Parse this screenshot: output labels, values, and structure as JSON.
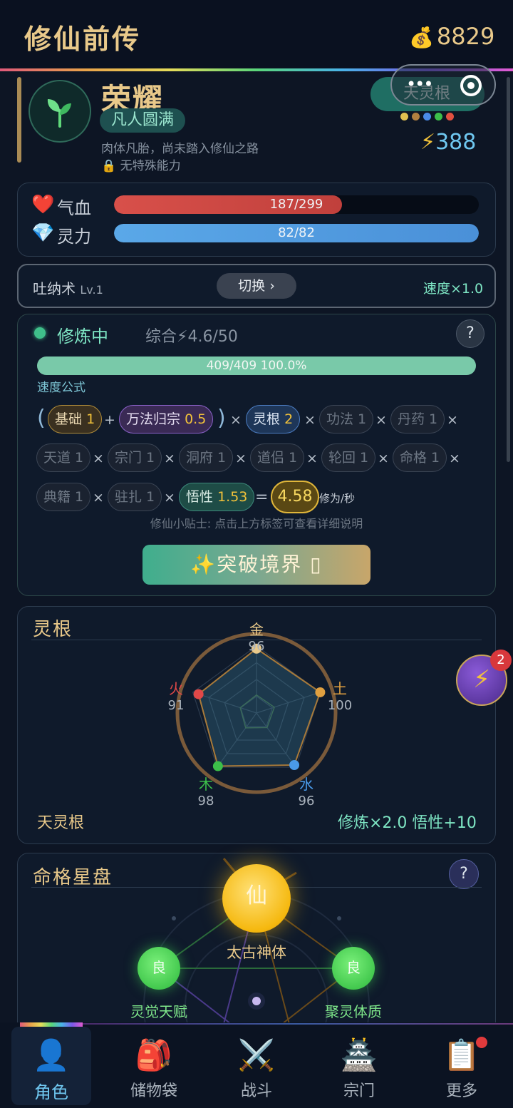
{
  "header": {
    "title": "修仙前传",
    "coin_icon": "money-bag-icon",
    "coins": "8829"
  },
  "profile": {
    "name": "荣耀",
    "realm": "凡人圆满",
    "description": "肉体凡胎，尚未踏入修仙之路",
    "ability": "无特殊能力",
    "root_pill": "天灵根",
    "root_dot_colors": [
      "#e0c050",
      "#b08040",
      "#4a8ae8",
      "#3cbf4a",
      "#e05040"
    ],
    "power": "388"
  },
  "stats": {
    "hp_label": "气血",
    "hp_text": "187/299",
    "hp_fraction": 0.625,
    "mp_label": "灵力",
    "mp_text": "82/82",
    "mp_fraction": 1.0
  },
  "technique": {
    "name": "吐纳术",
    "level": "Lv.1",
    "switch_label": "切换 ›",
    "speed": "速度×1.0"
  },
  "cultivation": {
    "status": "修炼中",
    "overall": "综合⚡4.6/50",
    "help": "?",
    "progress_text": "409/409  100.0%",
    "progress_fraction": 1.0,
    "formula_label": "速度公式",
    "chips": {
      "base": "基础",
      "base_v": "1",
      "method": "万法归宗",
      "method_v": "0.5",
      "root": "灵根",
      "root_v": "2",
      "skill": "功法 1",
      "pill": "丹药 1",
      "heaven": "天道 1",
      "sect": "宗门 1",
      "cave": "洞府 1",
      "partner": "道侣 1",
      "reincarnation": "轮回 1",
      "fate": "命格 1",
      "scripture": "典籍 1",
      "garrison": "驻扎 1",
      "insight": "悟性",
      "insight_v": "1.53",
      "result": "4.58",
      "unit": "修为/秒"
    },
    "tip": "修仙小贴士: 点击上方标签可查看详细说明",
    "breakthrough": "✨突破境界 ▯"
  },
  "spirit_root": {
    "title": "灵根",
    "elements": [
      {
        "name": "金",
        "value": "96",
        "color": "#e9c98a"
      },
      {
        "name": "土",
        "value": "100",
        "color": "#e0a040"
      },
      {
        "name": "水",
        "value": "96",
        "color": "#4a9ae8"
      },
      {
        "name": "木",
        "value": "98",
        "color": "#3cbf4a"
      },
      {
        "name": "火",
        "value": "91",
        "color": "#e04848"
      }
    ],
    "type": "天灵根",
    "bonus": "修炼×2.0  悟性+10",
    "float_badge": "2"
  },
  "star_chart": {
    "title": "命格星盘",
    "help": "?",
    "center": {
      "glyph": "仙",
      "label": "太古神体"
    },
    "left": {
      "glyph": "良",
      "label": "灵觉天赋"
    },
    "right": {
      "glyph": "良",
      "label": "聚灵体质"
    }
  },
  "nav": [
    {
      "label": "角色",
      "icon": "person-icon"
    },
    {
      "label": "储物袋",
      "icon": "backpack-icon"
    },
    {
      "label": "战斗",
      "icon": "crossed-swords-icon"
    },
    {
      "label": "宗门",
      "icon": "pagoda-icon"
    },
    {
      "label": "更多",
      "icon": "clipboard-icon"
    }
  ]
}
